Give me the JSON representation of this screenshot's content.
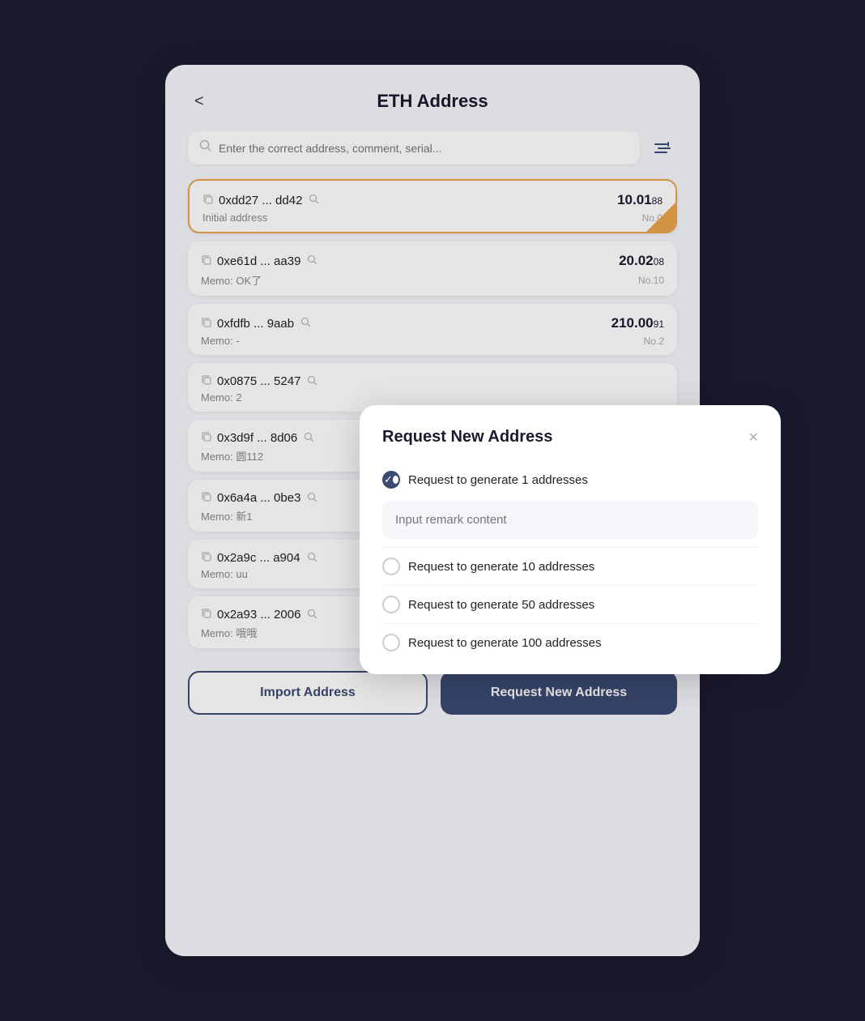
{
  "header": {
    "title": "ETH Address",
    "back_label": "<"
  },
  "search": {
    "placeholder": "Enter the correct address, comment, serial..."
  },
  "address_list": [
    {
      "address": "0xdd27 ... dd42",
      "memo": "Initial address",
      "amount_main": "10.01",
      "amount_small": "88",
      "no_label": "No.0",
      "active": true
    },
    {
      "address": "0xe61d ... aa39",
      "memo": "Memo: OK了",
      "amount_main": "20.02",
      "amount_small": "08",
      "no_label": "No.10",
      "active": false
    },
    {
      "address": "0xfdfb ... 9aab",
      "memo": "Memo: -",
      "amount_main": "210.00",
      "amount_small": "91",
      "no_label": "No.2",
      "active": false
    },
    {
      "address": "0x0875 ... 5247",
      "memo": "Memo: 2",
      "amount_main": "",
      "amount_small": "",
      "no_label": "",
      "active": false
    },
    {
      "address": "0x3d9f ... 8d06",
      "memo": "Memo: 圆112",
      "amount_main": "",
      "amount_small": "",
      "no_label": "",
      "active": false
    },
    {
      "address": "0x6a4a ... 0be3",
      "memo": "Memo: 新1",
      "amount_main": "",
      "amount_small": "",
      "no_label": "",
      "active": false
    },
    {
      "address": "0x2a9c ... a904",
      "memo": "Memo: uu",
      "amount_main": "",
      "amount_small": "",
      "no_label": "",
      "active": false
    },
    {
      "address": "0x2a93 ... 2006",
      "memo": "Memo: 哦哦",
      "amount_main": "",
      "amount_small": "",
      "no_label": "",
      "active": false
    }
  ],
  "bottom_buttons": {
    "import_label": "Import Address",
    "request_label": "Request New Address"
  },
  "modal": {
    "title": "Request New Address",
    "close_label": "×",
    "remark_placeholder": "Input remark content",
    "options": [
      {
        "label": "Request to generate 1 addresses",
        "checked": true
      },
      {
        "label": "Request to generate 10 addresses",
        "checked": false
      },
      {
        "label": "Request to generate 50 addresses",
        "checked": false
      },
      {
        "label": "Request to generate 100 addresses",
        "checked": false
      }
    ]
  }
}
